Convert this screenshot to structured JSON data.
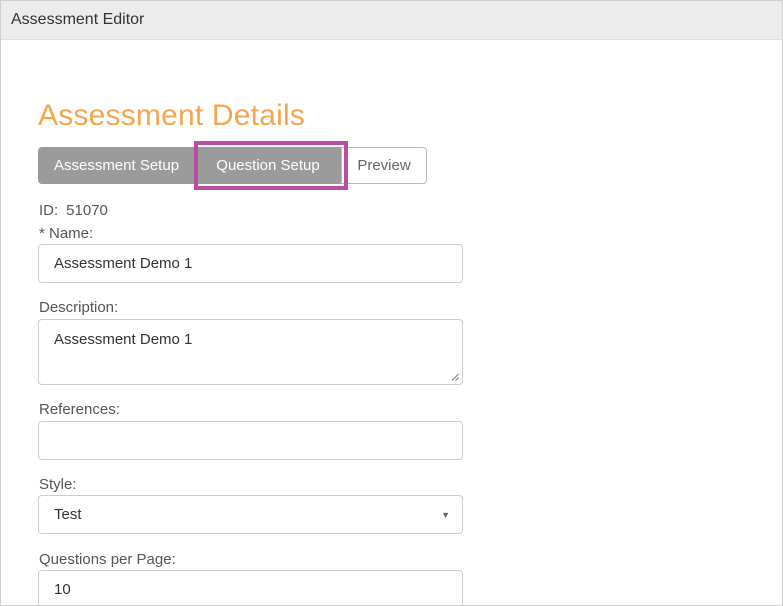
{
  "window": {
    "title": "Assessment Editor"
  },
  "page": {
    "heading": "Assessment Details"
  },
  "tabs": [
    {
      "label": "Assessment Setup"
    },
    {
      "label": "Question Setup"
    },
    {
      "label": "Preview"
    }
  ],
  "details": {
    "id_label": "ID:",
    "id_value": "51070"
  },
  "form": {
    "name": {
      "label": "* Name:",
      "value": "Assessment Demo 1"
    },
    "description": {
      "label": "Description:",
      "value": "Assessment Demo 1"
    },
    "references": {
      "label": "References:",
      "value": ""
    },
    "style": {
      "label": "Style:",
      "value": "Test"
    },
    "questions_per_page": {
      "label": "Questions per Page:",
      "value": "10"
    }
  },
  "colors": {
    "heading": "#f4a64f",
    "tab_active": "#9b9b9b",
    "highlight": "#b94ca3"
  }
}
